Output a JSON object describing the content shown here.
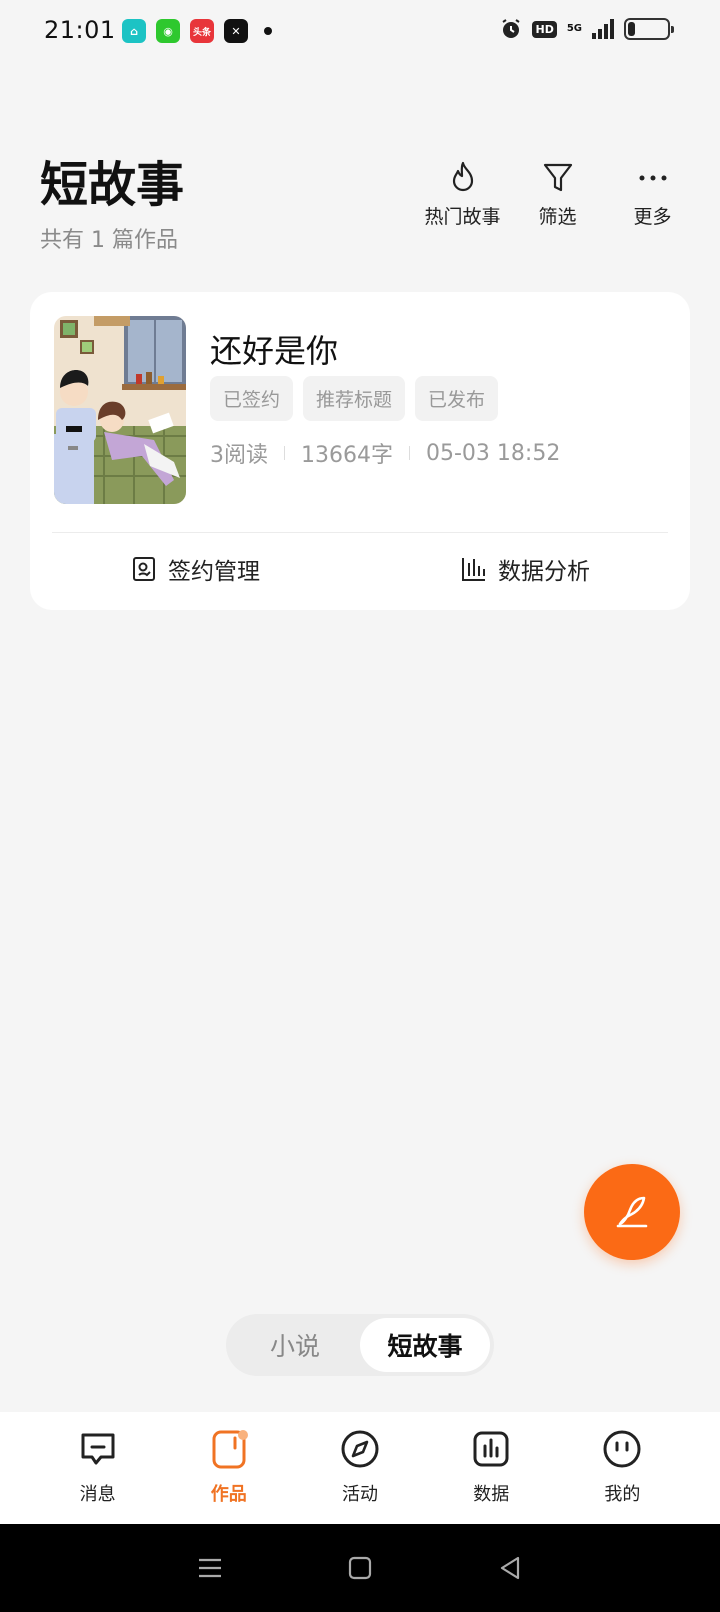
{
  "status_bar": {
    "time": "21:01",
    "notif_app_text": "头条",
    "hd": "HD",
    "network": "5G",
    "battery_level": 0.18
  },
  "header": {
    "title": "短故事",
    "subtitle": "共有 1 篇作品",
    "actions": [
      {
        "label": "热门故事",
        "icon": "flame-icon"
      },
      {
        "label": "筛选",
        "icon": "filter-icon"
      },
      {
        "label": "更多",
        "icon": "more-dots-icon"
      }
    ]
  },
  "work": {
    "title": "还好是你",
    "tags": [
      "已签约",
      "推荐标题",
      "已发布"
    ],
    "reads": "3阅读",
    "words": "13664字",
    "date": "05-03 18:52",
    "actions": [
      {
        "label": "签约管理",
        "icon": "contract-icon"
      },
      {
        "label": "数据分析",
        "icon": "bar-chart-icon"
      }
    ]
  },
  "fab": {
    "icon": "quill-pen-icon",
    "color": "#fb6a15"
  },
  "segment": {
    "options": [
      "小说",
      "短故事"
    ],
    "selected": "短故事"
  },
  "bottom_nav": {
    "items": [
      {
        "label": "消息",
        "icon": "message-icon"
      },
      {
        "label": "作品",
        "icon": "works-icon"
      },
      {
        "label": "活动",
        "icon": "compass-icon"
      },
      {
        "label": "数据",
        "icon": "data-icon"
      },
      {
        "label": "我的",
        "icon": "profile-face-icon"
      }
    ],
    "active": "作品",
    "active_color": "#f07323"
  }
}
